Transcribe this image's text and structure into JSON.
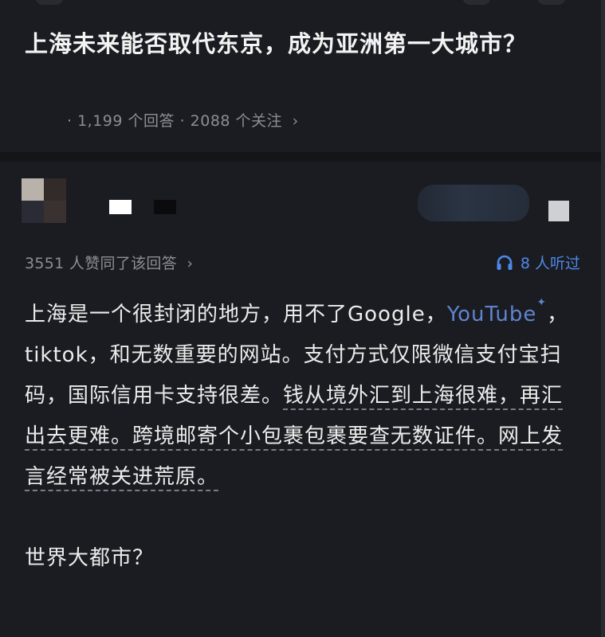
{
  "question": {
    "title": "上海未来能否取代东京，成为亚洲第一大城市？",
    "answer_count": "· 1,199 个回答",
    "follow_count": "· 2088 个关注",
    "chevron": "›"
  },
  "answer": {
    "vote_text": "3551 人赞同了该回答",
    "vote_chevron": "›",
    "listen_text": "8 人听过",
    "para1_a": "上海是一个很封闭的地方，用不了Google，",
    "link_youtube": "YouTube",
    "link_mark": "✦",
    "para1_b": "，tiktok，和无数重要的网站。支付方式仅限微信支付宝扫码，国际信用卡支持很差。",
    "para1_c": "钱从境外汇到上海很难，再汇出去更难。跨境邮寄个小包裹包裹要查无数证件。网上发言经常被关进荒原。",
    "para2": "世界大都市？"
  },
  "colors": {
    "background": "#1b1c21",
    "link": "#5f84cf",
    "accent_blue": "#4e88e8",
    "muted_text": "#8d8e94"
  },
  "icons": {
    "listen": "headphone-icon",
    "more": "chevron-right-icon"
  }
}
